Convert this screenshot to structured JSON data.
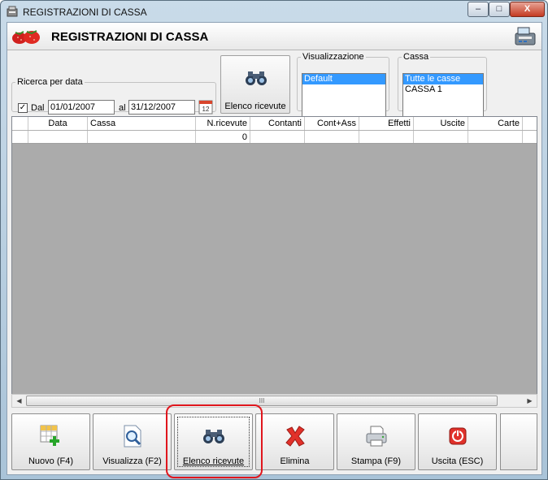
{
  "window": {
    "title": "REGISTRAZIONI DI CASSA",
    "icon": "cash-register-icon",
    "controls": {
      "minimize": "–",
      "maximize": "□",
      "close": "X"
    }
  },
  "header": {
    "title": "REGISTRAZIONI DI CASSA",
    "logo": "strawberries-logo",
    "right_icon": "cash-register-icon"
  },
  "search": {
    "legend": "Ricerca per data",
    "checked": true,
    "check_mark": "✓",
    "from_label": "Dal",
    "from_value": "01/01/2007",
    "to_label": "al",
    "to_value": "31/12/2007",
    "calendar_icon": "calendar-icon"
  },
  "toolbar": {
    "elenco_label": "Elenco ricevute",
    "elenco_icon": "binoculars-icon"
  },
  "visualizzazione": {
    "legend": "Visualizzazione",
    "items": [
      "Default"
    ],
    "selected": "Default"
  },
  "cassa": {
    "legend": "Cassa",
    "items": [
      "Tutte le casse",
      "CASSA 1"
    ],
    "selected": "Tutte le casse"
  },
  "grid": {
    "columns": [
      "",
      "Data",
      "Cassa",
      "N.ricevute",
      "Contanti",
      "Cont+Ass",
      "Effetti",
      "Uscite",
      "Carte"
    ],
    "rows": [
      [
        "",
        "",
        "",
        "0",
        "",
        "",
        "",
        "",
        ""
      ]
    ]
  },
  "scrollbar": {
    "left": "◀",
    "right": "▶",
    "grip": "III"
  },
  "buttons": [
    {
      "label": "Nuovo (F4)",
      "icon": "new-grid-plus-icon"
    },
    {
      "label": "Visualizza (F2)",
      "icon": "magnifier-document-icon"
    },
    {
      "label": "Elenco ricevute",
      "icon": "binoculars-icon"
    },
    {
      "label": "Elimina",
      "icon": "red-x-icon"
    },
    {
      "label": "Stampa (F9)",
      "icon": "printer-icon"
    },
    {
      "label": "Uscita (ESC)",
      "icon": "power-icon"
    }
  ],
  "colors": {
    "selection": "#3399ff",
    "highlight_outline": "#e0161d",
    "grid_background": "#ababab"
  }
}
